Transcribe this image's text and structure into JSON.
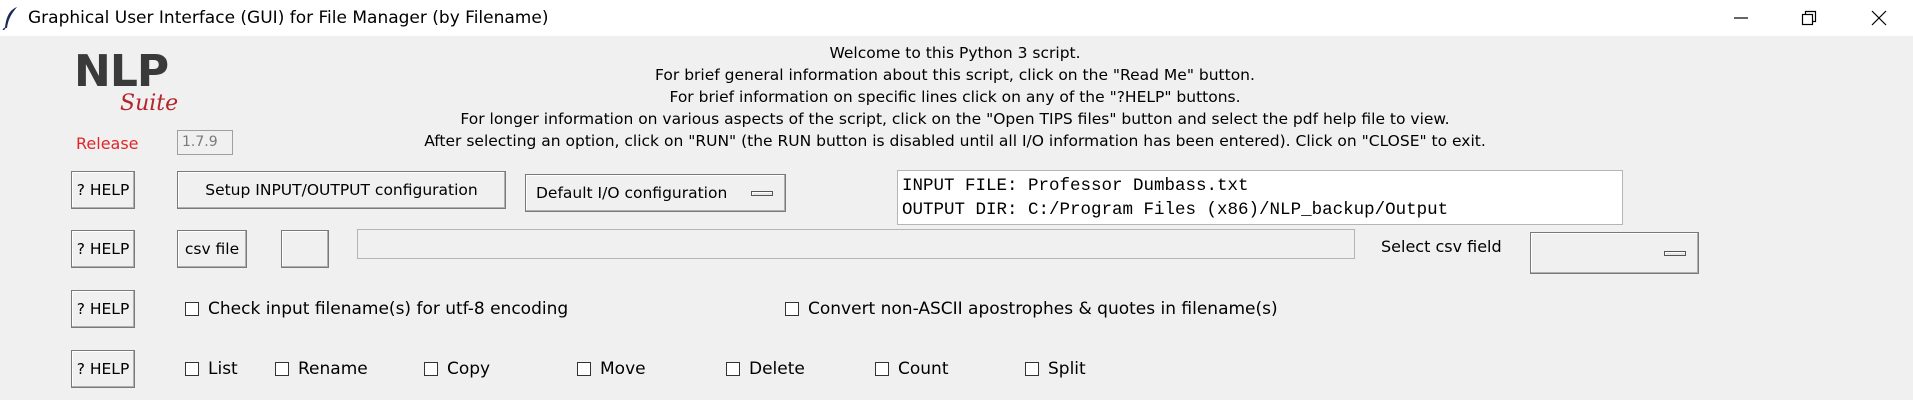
{
  "window": {
    "title": "Graphical User Interface (GUI) for File Manager (by Filename)",
    "controls": {
      "minimize": "minimize",
      "restore": "restore",
      "close": "close"
    }
  },
  "logo": {
    "nlp": "NLP",
    "suite": "Suite"
  },
  "release": {
    "label": "Release",
    "version": "1.7.9"
  },
  "intro_lines": [
    "Welcome to this Python 3 script.",
    "For brief general information about this script, click on the \"Read Me\" button.",
    "For brief information on specific lines click on any of the \"?HELP\" buttons.",
    "For longer information on various aspects of the script, click on the \"Open TIPS files\" button and select the pdf help file to view.",
    "After selecting an option, click on \"RUN\" (the RUN button is disabled until all I/O information has been entered).   Click on \"CLOSE\" to exit."
  ],
  "help_label": "? HELP",
  "row1": {
    "setup_button": "Setup INPUT/OUTPUT configuration",
    "io_config_menu": "Default I/O configuration",
    "input_file": "INPUT FILE: Professor Dumbass.txt",
    "output_dir": "OUTPUT DIR: C:/Program Files (x86)/NLP_backup/Output"
  },
  "row2": {
    "csv_button": "csv file",
    "blank_button": "",
    "csv_path": "",
    "select_label": "Select csv field",
    "select_value": ""
  },
  "row3": {
    "utf8_check": "Check input filename(s) for utf-8 encoding",
    "ascii_check": "Convert non-ASCII apostrophes & quotes in filename(s)"
  },
  "row4": {
    "options": [
      "List",
      "Rename",
      "Copy",
      "Move",
      "Delete",
      "Count",
      "Split"
    ]
  },
  "colors": {
    "release_red": "#e0262a",
    "suite_red": "#b3262a",
    "logo_gray": "#3a3a3a",
    "background": "#f0f0f0"
  }
}
